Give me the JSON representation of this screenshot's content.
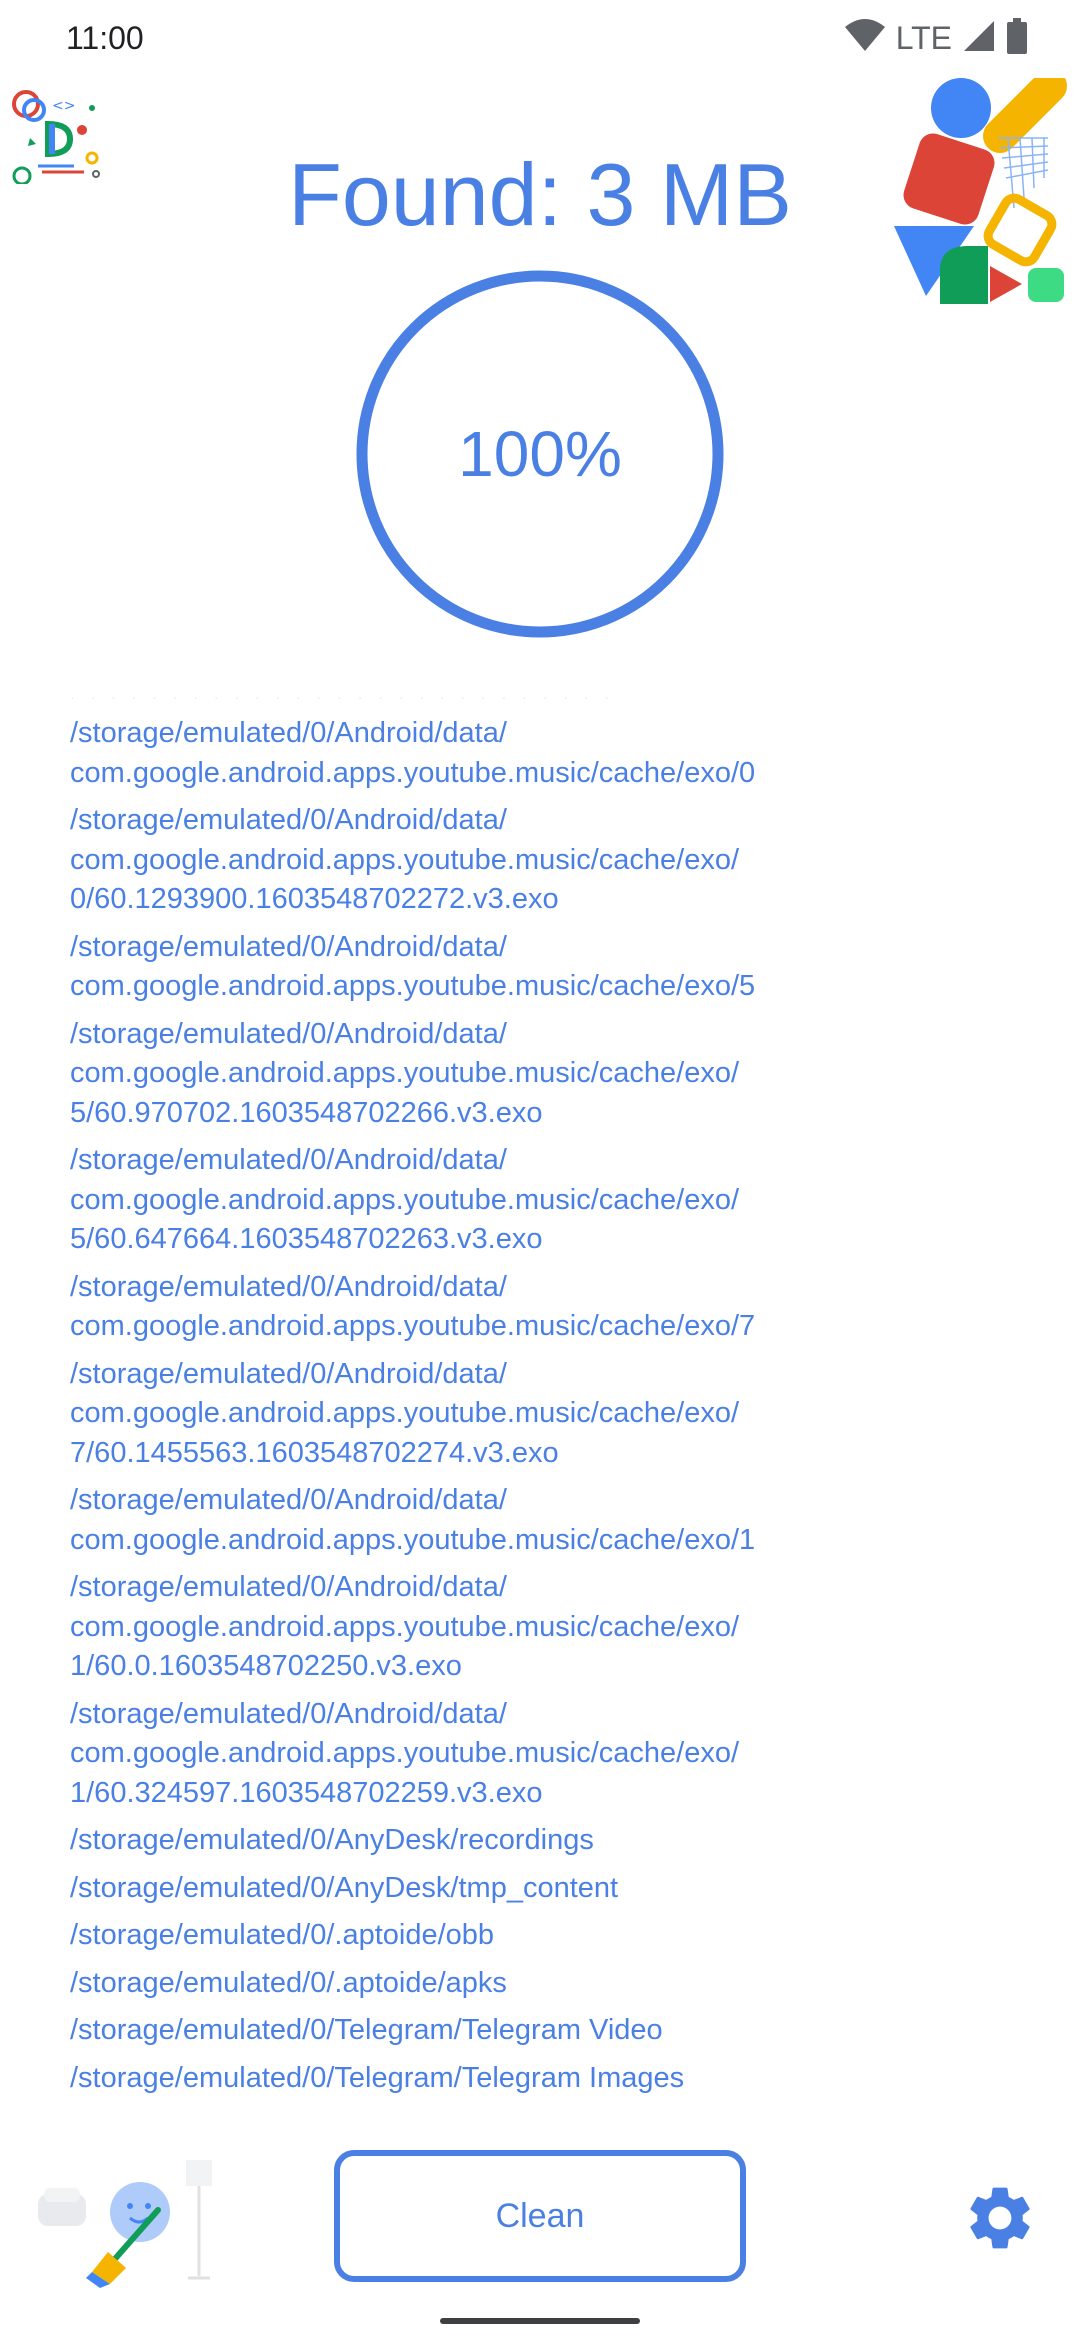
{
  "status_bar": {
    "time": "11:00",
    "network": "LTE",
    "icons": [
      "wifi-icon",
      "cell-signal-icon",
      "battery-icon"
    ]
  },
  "header": {
    "title": "Found: 3 MB"
  },
  "progress": {
    "label": "100%",
    "value": 1.0
  },
  "file_list": {
    "items": [
      "/storage/emulated/0/Android/data/\ncom.google.android.apps.youtube.music/cache/exo/0",
      "/storage/emulated/0/Android/data/\ncom.google.android.apps.youtube.music/cache/exo/\n0/60.1293900.1603548702272.v3.exo",
      "/storage/emulated/0/Android/data/\ncom.google.android.apps.youtube.music/cache/exo/5",
      "/storage/emulated/0/Android/data/\ncom.google.android.apps.youtube.music/cache/exo/\n5/60.970702.1603548702266.v3.exo",
      "/storage/emulated/0/Android/data/\ncom.google.android.apps.youtube.music/cache/exo/\n5/60.647664.1603548702263.v3.exo",
      "/storage/emulated/0/Android/data/\ncom.google.android.apps.youtube.music/cache/exo/7",
      "/storage/emulated/0/Android/data/\ncom.google.android.apps.youtube.music/cache/exo/\n7/60.1455563.1603548702274.v3.exo",
      "/storage/emulated/0/Android/data/\ncom.google.android.apps.youtube.music/cache/exo/1",
      "/storage/emulated/0/Android/data/\ncom.google.android.apps.youtube.music/cache/exo/\n1/60.0.1603548702250.v3.exo",
      "/storage/emulated/0/Android/data/\ncom.google.android.apps.youtube.music/cache/exo/\n1/60.324597.1603548702259.v3.exo",
      "/storage/emulated/0/AnyDesk/recordings",
      "/storage/emulated/0/AnyDesk/tmp_content",
      "/storage/emulated/0/.aptoide/obb",
      "/storage/emulated/0/.aptoide/apks",
      "/storage/emulated/0/Telegram/Telegram Video",
      "/storage/emulated/0/Telegram/Telegram Images"
    ]
  },
  "actions": {
    "clean_label": "Clean"
  },
  "colors": {
    "accent": "#4a80e4",
    "text_dark": "#202124",
    "icon_gray": "#5f6368",
    "background": "#ffffff"
  },
  "icons": {
    "decor_left": "doodle-logo-icon",
    "decor_right": "shapes-decoration-icon",
    "bottom_left": "cleaning-broom-mascot-icon",
    "settings": "gear-icon"
  }
}
